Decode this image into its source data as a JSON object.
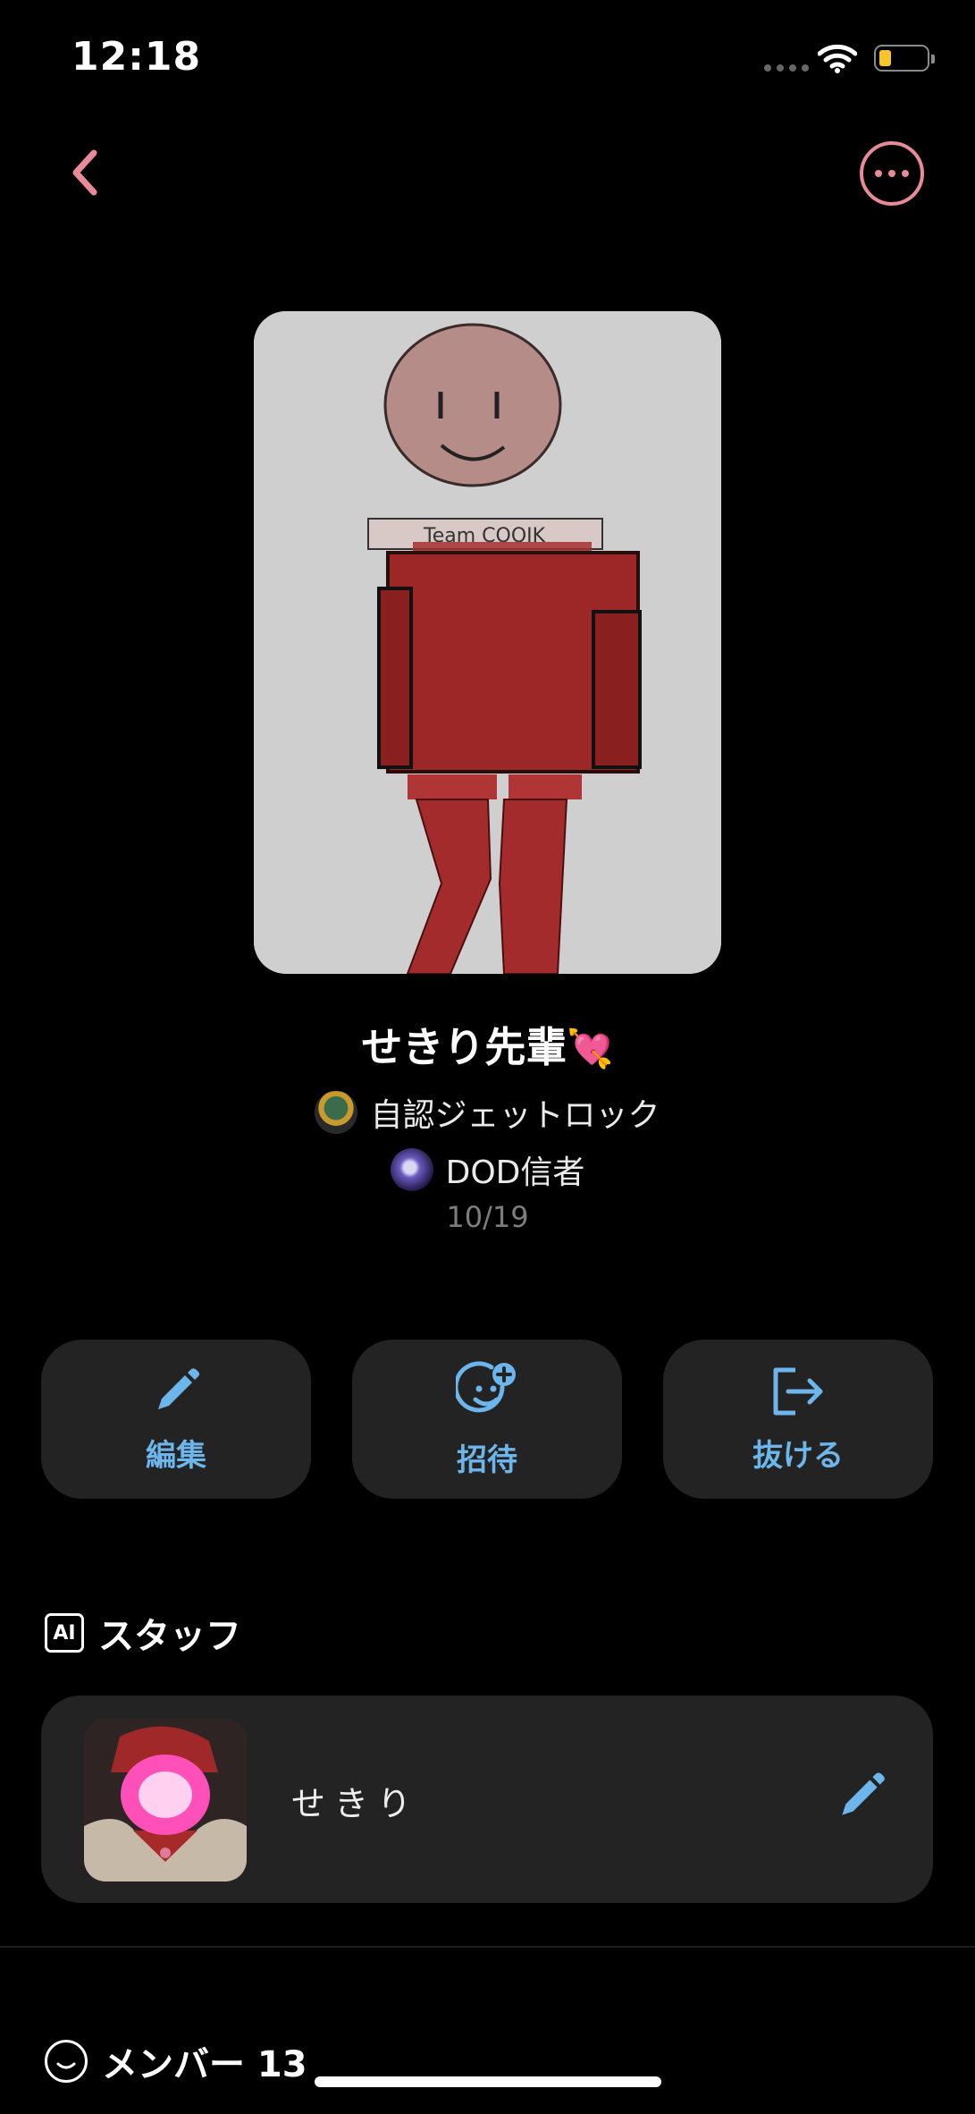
{
  "status_bar": {
    "time": "12:18"
  },
  "nav": {
    "back_icon": "chevron-left-icon",
    "more_icon": "ellipsis-icon",
    "accent_color": "#e88a98"
  },
  "group": {
    "name": "せきり先輩",
    "name_emoji": "💘",
    "tags": [
      "自認ジェットロック",
      "DOD信者"
    ],
    "date": "10/19",
    "cover_text": "Team COOIK"
  },
  "actions": [
    {
      "label": "編集",
      "icon": "pencil-icon"
    },
    {
      "label": "招待",
      "icon": "add-person-icon"
    },
    {
      "label": "抜ける",
      "icon": "exit-icon"
    }
  ],
  "staff_section": {
    "badge": "AI",
    "title": "スタッフ",
    "member_name": "せきり"
  },
  "members_section": {
    "title": "メンバー 13"
  },
  "colors": {
    "action_text": "#6db6ec",
    "card_bg": "#232323",
    "battery": "#f7c52b"
  }
}
